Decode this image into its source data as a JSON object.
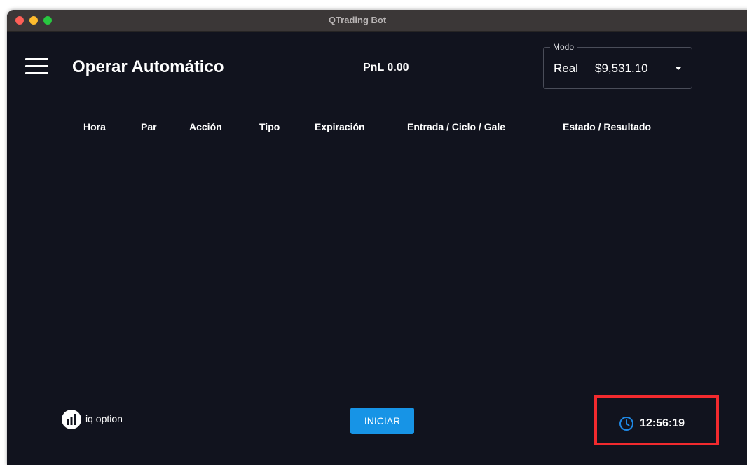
{
  "window": {
    "title": "QTrading Bot"
  },
  "header": {
    "title": "Operar Automático",
    "pnl": "PnL 0.00",
    "mode": {
      "label": "Modo",
      "value": "Real",
      "balance": "$9,531.10"
    }
  },
  "table": {
    "columns": [
      "Hora",
      "Par",
      "Acción",
      "Tipo",
      "Expiración",
      "Entrada / Ciclo / Gale",
      "Estado / Resultado"
    ],
    "rows": []
  },
  "footer": {
    "brand": "iq option",
    "start_label": "INICIAR",
    "clock_time": "12:56:19"
  },
  "icons": {
    "menu": "hamburger-menu-icon",
    "clock": "clock-icon",
    "brand": "iq-option-logo-icon",
    "dropdown": "caret-down-icon"
  },
  "colors": {
    "background": "#11131e",
    "accent": "#1794e6",
    "highlight_border": "#f22a2e",
    "titlebar": "#3b3737"
  }
}
